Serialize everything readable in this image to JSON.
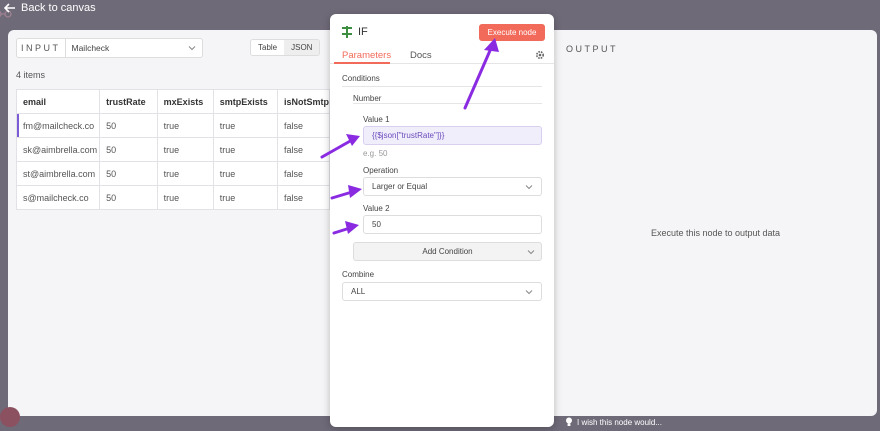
{
  "topbar": {
    "back_label": "Back to canvas"
  },
  "input": {
    "label": "INPUT",
    "selected_node": "Mailcheck",
    "view_options": [
      "Table",
      "JSON"
    ],
    "active_view": "Table",
    "item_count": "4 items",
    "columns": [
      "email",
      "trustRate",
      "mxExists",
      "smtpExists",
      "isNotSmtp"
    ],
    "rows": [
      [
        "fm@mailcheck.co",
        "50",
        "true",
        "true",
        "false"
      ],
      [
        "sk@aimbrella.com",
        "50",
        "true",
        "true",
        "false"
      ],
      [
        "st@aimbrella.com",
        "50",
        "true",
        "true",
        "false"
      ],
      [
        "s@mailcheck.co",
        "50",
        "true",
        "true",
        "false"
      ]
    ]
  },
  "node": {
    "icon": "if-icon",
    "title": "IF",
    "execute_label": "Execute node",
    "tabs": [
      "Parameters",
      "Docs"
    ],
    "active_tab": "Parameters",
    "conditions_label": "Conditions",
    "number_label": "Number",
    "value1_label": "Value 1",
    "value1": "{{$json[\"trustRate\"]}}",
    "value1_hint": "e.g. 50",
    "operation_label": "Operation",
    "operation_value": "Larger or Equal",
    "value2_label": "Value 2",
    "value2": "50",
    "add_condition_label": "Add Condition",
    "combine_label": "Combine",
    "combine_value": "ALL"
  },
  "output": {
    "label": "OUTPUT",
    "message": "Execute this node to output data"
  },
  "feedback": {
    "label": "I wish this node would..."
  },
  "colors": {
    "accent": "#f26a5a",
    "annotation_arrow": "#8a2be2",
    "expression": "#6b4bbd",
    "backdrop": "#6f6a78"
  }
}
